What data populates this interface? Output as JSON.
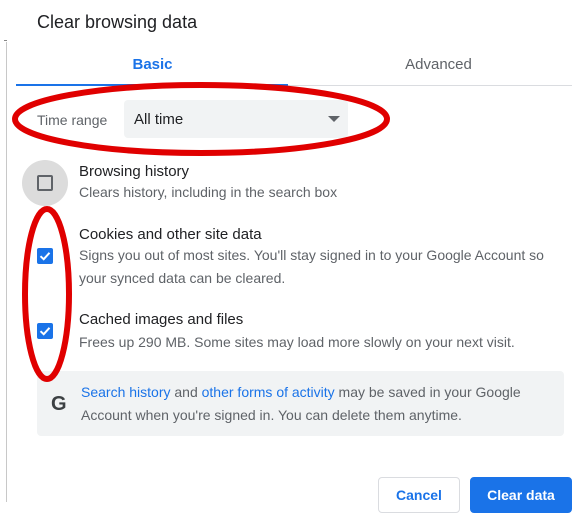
{
  "dialog": {
    "title": "Clear browsing data"
  },
  "tabs": [
    {
      "label": "Basic",
      "active": true
    },
    {
      "label": "Advanced",
      "active": false
    }
  ],
  "time_range": {
    "label": "Time range",
    "value": "All time"
  },
  "items": [
    {
      "title": "Browsing history",
      "description": "Clears history, including in the search box",
      "checked": false
    },
    {
      "title": "Cookies and other site data",
      "description": "Signs you out of most sites. You'll stay signed in to your Google Account so your synced data can be cleared.",
      "checked": true
    },
    {
      "title": "Cached images and files",
      "description": "Frees up 290 MB. Some sites may load more slowly on your next visit.",
      "checked": true
    }
  ],
  "info": {
    "icon": "google-g-icon",
    "link1": "Search history",
    "text1": " and ",
    "link2": "other forms of activity",
    "text2": " may be saved in your Google Account when you're signed in. You can delete them anytime."
  },
  "buttons": {
    "cancel": "Cancel",
    "clear": "Clear data"
  },
  "colors": {
    "accent": "#1a73e8",
    "annotation": "#e00000"
  }
}
